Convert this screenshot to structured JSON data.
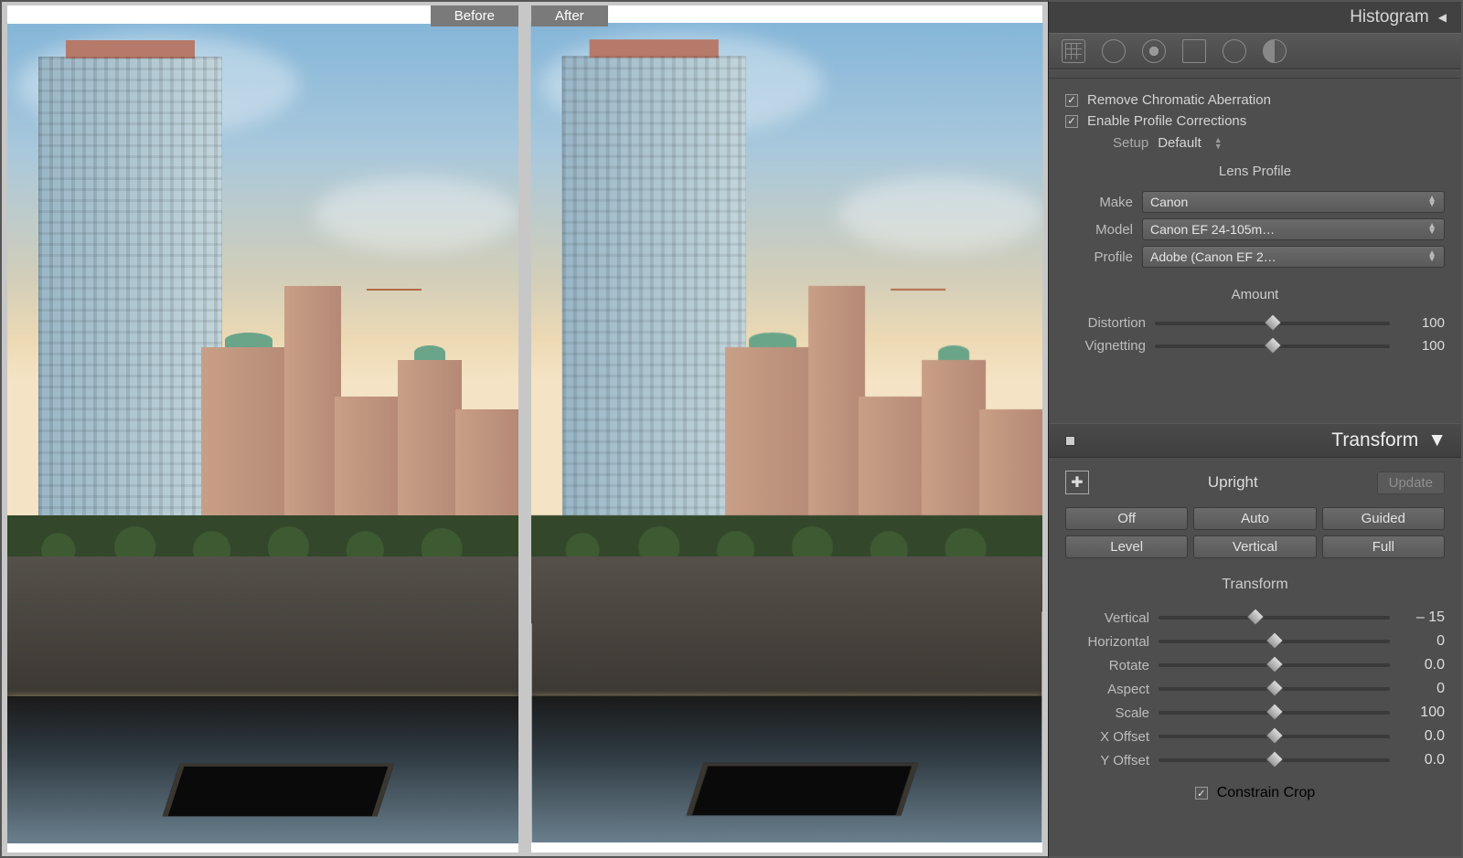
{
  "preview": {
    "before_label": "Before",
    "after_label": "After"
  },
  "histogram_title": "Histogram",
  "lens_corrections": {
    "remove_chromatic": "Remove Chromatic Aberration",
    "enable_profile": "Enable Profile Corrections",
    "setup_label": "Setup",
    "setup_value": "Default",
    "profile_header": "Lens Profile",
    "make_label": "Make",
    "make_value": "Canon",
    "model_label": "Model",
    "model_value": "Canon EF 24-105m…",
    "profile_label": "Profile",
    "profile_value": "Adobe (Canon EF 2…",
    "amount_header": "Amount",
    "distortion_label": "Distortion",
    "distortion_value": "100",
    "vignetting_label": "Vignetting",
    "vignetting_value": "100"
  },
  "transform_panel": {
    "title": "Transform",
    "upright_label": "Upright",
    "update_label": "Update",
    "buttons": {
      "off": "Off",
      "auto": "Auto",
      "guided": "Guided",
      "level": "Level",
      "vertical": "Vertical",
      "full": "Full"
    },
    "section_label": "Transform",
    "sliders": {
      "vertical": {
        "label": "Vertical",
        "value": "– 15",
        "pos": 42
      },
      "horizontal": {
        "label": "Horizontal",
        "value": "0",
        "pos": 50
      },
      "rotate": {
        "label": "Rotate",
        "value": "0.0",
        "pos": 50
      },
      "aspect": {
        "label": "Aspect",
        "value": "0",
        "pos": 50
      },
      "scale": {
        "label": "Scale",
        "value": "100",
        "pos": 50
      },
      "xoffset": {
        "label": "X Offset",
        "value": "0.0",
        "pos": 50
      },
      "yoffset": {
        "label": "Y Offset",
        "value": "0.0",
        "pos": 50
      }
    },
    "constrain_crop": "Constrain Crop"
  }
}
